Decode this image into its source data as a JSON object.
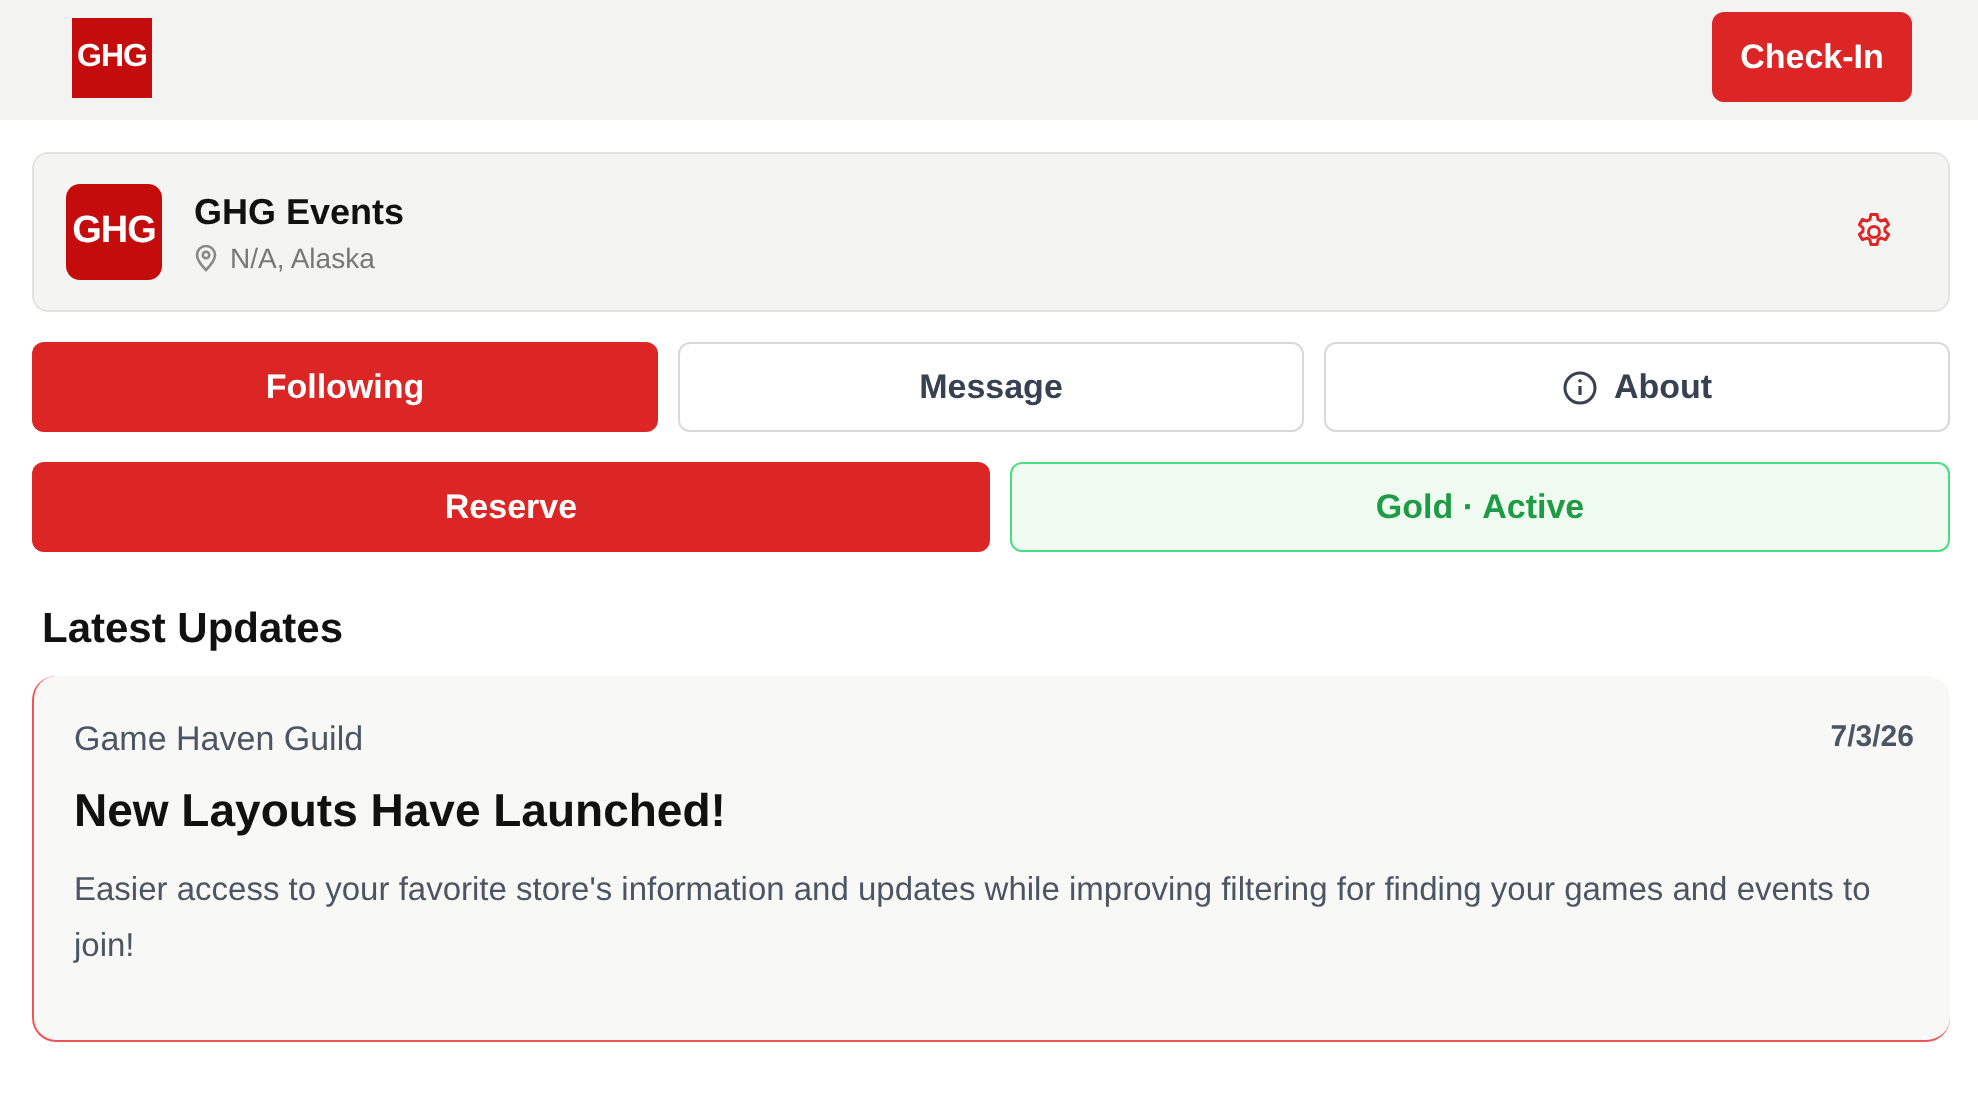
{
  "header": {
    "logo": "GHG",
    "check_in_button": "Check-In"
  },
  "store": {
    "logo": "GHG",
    "name": "GHG Events",
    "location": "N/A, Alaska"
  },
  "actions": [
    {
      "label": "Following",
      "kind": "primary"
    },
    {
      "label": "Message",
      "kind": "outline"
    },
    {
      "label": "About",
      "kind": "info"
    }
  ],
  "reserve_button": "Reserve",
  "membership": {
    "tier": "Gold",
    "separator": "·",
    "status": "Active",
    "active": true
  },
  "updates": {
    "heading": "Latest Updates",
    "posts": [
      {
        "author": "Game Haven Guild",
        "date": "7/3/26",
        "title": "New Layouts Have Launched!",
        "body": "Easier access to your favorite store's information and updates while improving filtering for finding your games and events to join!"
      }
    ]
  }
}
